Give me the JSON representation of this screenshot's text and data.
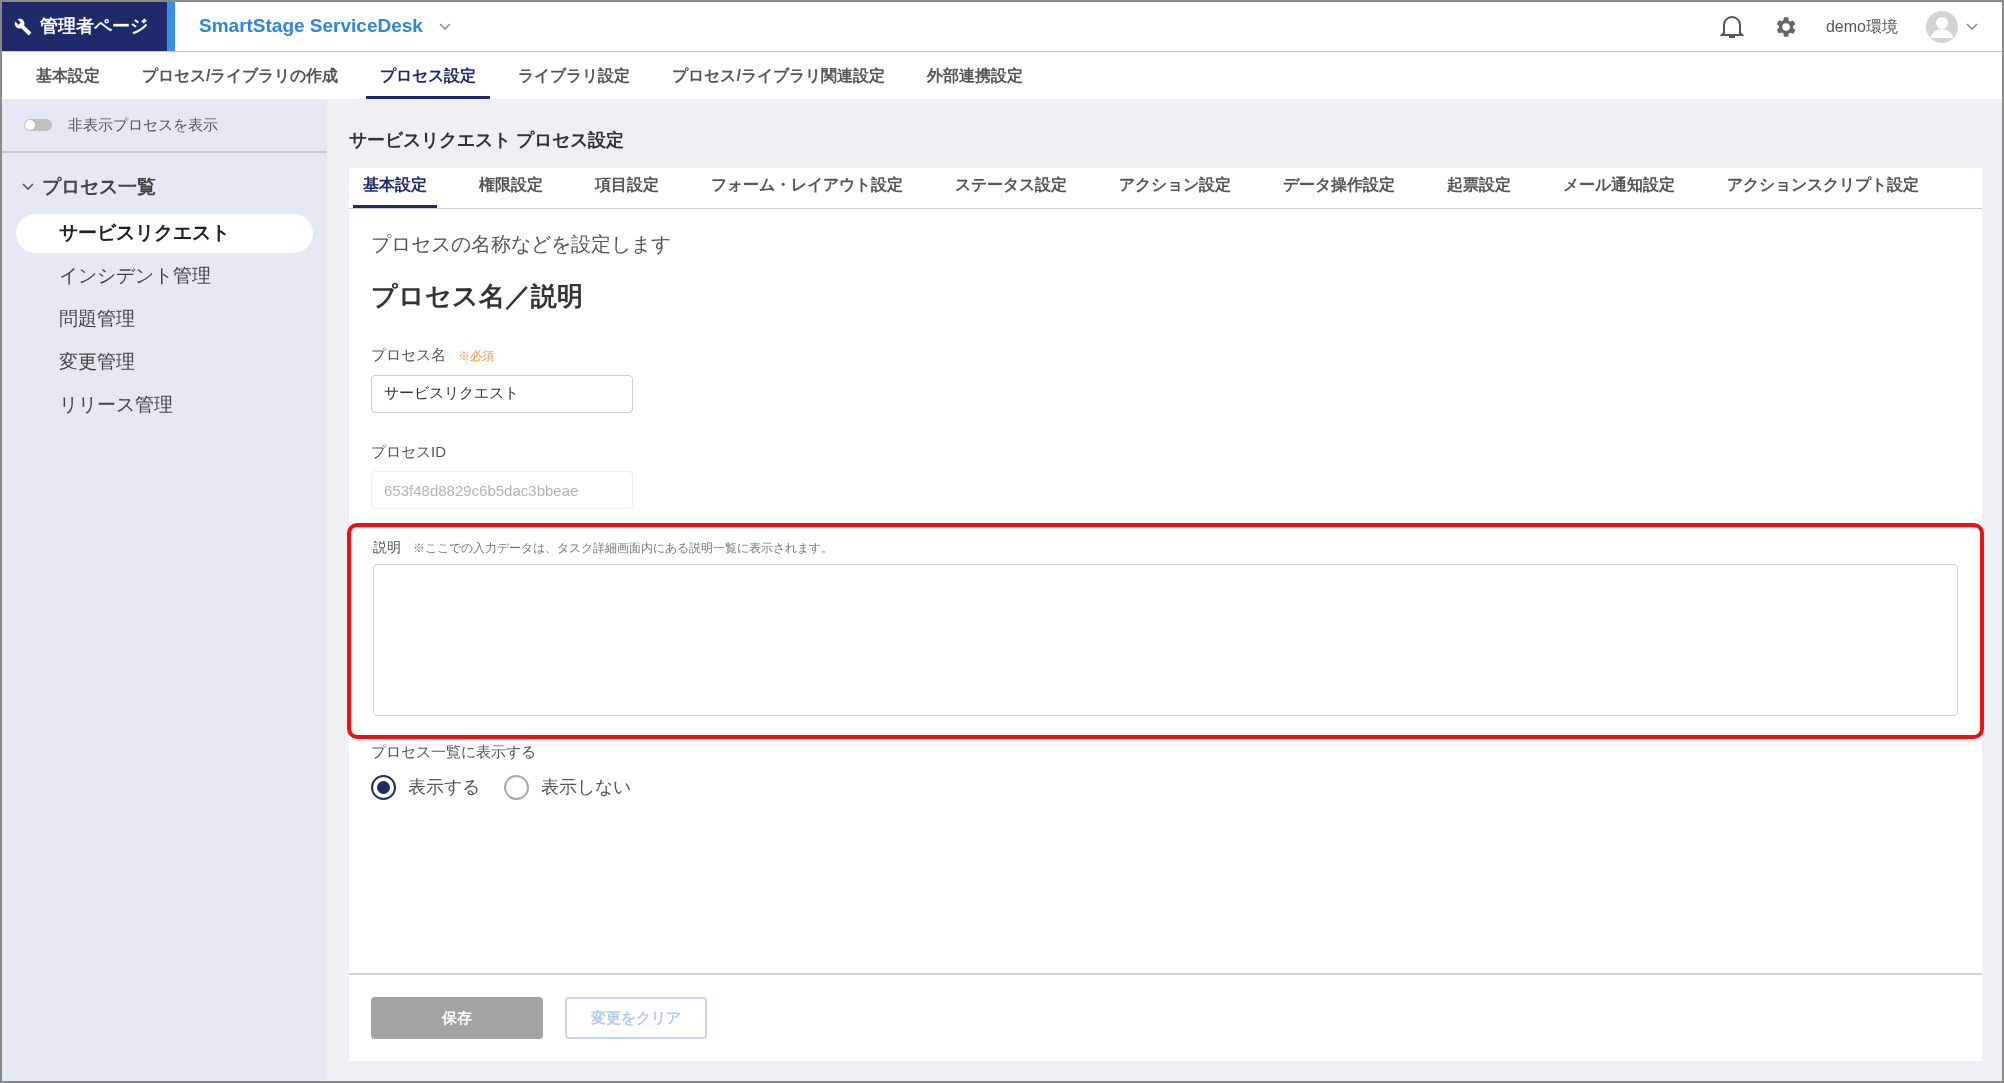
{
  "header": {
    "brand": "管理者ページ",
    "app_name": "SmartStage ServiceDesk",
    "environment": "demo環境"
  },
  "nav_tabs": [
    {
      "label": "基本設定",
      "selected": false
    },
    {
      "label": "プロセス/ライブラリの作成",
      "selected": false
    },
    {
      "label": "プロセス設定",
      "selected": true
    },
    {
      "label": "ライブラリ設定",
      "selected": false
    },
    {
      "label": "プロセス/ライブラリ関連設定",
      "selected": false
    },
    {
      "label": "外部連携設定",
      "selected": false
    }
  ],
  "sidebar": {
    "toggle": {
      "label": "非表示プロセスを表示",
      "on": false
    },
    "group": {
      "label": "プロセス一覧",
      "expanded": true
    },
    "items": [
      {
        "label": "サービスリクエスト",
        "selected": true
      },
      {
        "label": "インシデント管理",
        "selected": false
      },
      {
        "label": "問題管理",
        "selected": false
      },
      {
        "label": "変更管理",
        "selected": false
      },
      {
        "label": "リリース管理",
        "selected": false
      }
    ]
  },
  "page_title": "サービスリクエスト プロセス設定",
  "tabs": [
    {
      "label": "基本設定",
      "selected": true
    },
    {
      "label": "権限設定",
      "selected": false
    },
    {
      "label": "項目設定",
      "selected": false
    },
    {
      "label": "フォーム・レイアウト設定",
      "selected": false
    },
    {
      "label": "ステータス設定",
      "selected": false
    },
    {
      "label": "アクション設定",
      "selected": false
    },
    {
      "label": "データ操作設定",
      "selected": false
    },
    {
      "label": "起票設定",
      "selected": false
    },
    {
      "label": "メール通知設定",
      "selected": false
    },
    {
      "label": "アクションスクリプト設定",
      "selected": false
    }
  ],
  "form": {
    "intro": "プロセスの名称などを設定します",
    "section_title": "プロセス名／説明",
    "process_name": {
      "label": "プロセス名",
      "required_note": "※必須",
      "value": "サービスリクエスト"
    },
    "process_id": {
      "label": "プロセスID",
      "value": "653f48d8829c6b5dac3bbeae",
      "disabled": true
    },
    "description": {
      "label": "説明",
      "note": "※ここでの入力データは、タスク詳細画面内にある説明一覧に表示されます。",
      "highlighted": true
    },
    "visibility": {
      "label": "プロセス一覧に表示する",
      "options": [
        {
          "label": "表示する",
          "selected": true
        },
        {
          "label": "表示しない",
          "selected": false
        }
      ]
    }
  },
  "buttons": [
    {
      "label": "保存",
      "kind": "primary",
      "disabled": true
    },
    {
      "label": "変更をクリア",
      "kind": "outline",
      "disabled": true
    }
  ]
}
